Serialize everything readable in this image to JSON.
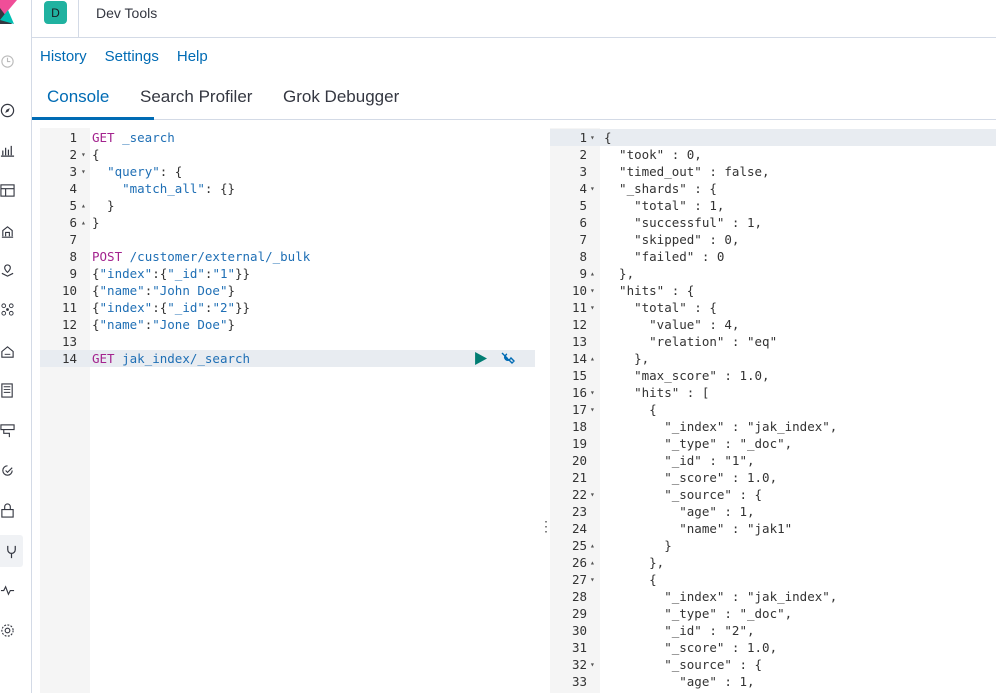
{
  "header": {
    "avatar_letter": "D",
    "app_title": "Dev Tools"
  },
  "menu": {
    "history": "History",
    "settings": "Settings",
    "help": "Help"
  },
  "tabs": [
    {
      "label": "Console"
    },
    {
      "label": "Search Profiler"
    },
    {
      "label": "Grok Debugger"
    }
  ],
  "sidenav": {
    "icons": [
      "clock-icon",
      "compass-icon",
      "visualize-icon",
      "dashboard-icon",
      "canvas-icon",
      "maps-icon",
      "ml-icon",
      "infrastructure-icon",
      "logs-icon",
      "apm-icon",
      "uptime-icon",
      "siem-icon",
      "devtools-icon",
      "monitoring-icon",
      "management-icon"
    ]
  },
  "editor": {
    "lines": [
      {
        "n": "1",
        "fold": "",
        "segments": [
          {
            "c": "verb",
            "t": "GET"
          },
          {
            "c": "plain",
            "t": " "
          },
          {
            "c": "str",
            "t": "_search"
          }
        ]
      },
      {
        "n": "2",
        "fold": "▾",
        "segments": [
          {
            "c": "plain",
            "t": "{"
          }
        ]
      },
      {
        "n": "3",
        "fold": "▾",
        "segments": [
          {
            "c": "plain",
            "t": "  "
          },
          {
            "c": "str",
            "t": "\"query\""
          },
          {
            "c": "plain",
            "t": ": {"
          }
        ]
      },
      {
        "n": "4",
        "fold": "",
        "segments": [
          {
            "c": "plain",
            "t": "    "
          },
          {
            "c": "str",
            "t": "\"match_all\""
          },
          {
            "c": "plain",
            "t": ": {}"
          }
        ]
      },
      {
        "n": "5",
        "fold": "▴",
        "segments": [
          {
            "c": "plain",
            "t": "  }"
          }
        ]
      },
      {
        "n": "6",
        "fold": "▴",
        "segments": [
          {
            "c": "plain",
            "t": "}"
          }
        ]
      },
      {
        "n": "7",
        "fold": "",
        "segments": []
      },
      {
        "n": "8",
        "fold": "",
        "segments": [
          {
            "c": "verb",
            "t": "POST"
          },
          {
            "c": "plain",
            "t": " "
          },
          {
            "c": "str",
            "t": "/customer/external/_bulk"
          }
        ]
      },
      {
        "n": "9",
        "fold": "",
        "segments": [
          {
            "c": "plain",
            "t": "{"
          },
          {
            "c": "str",
            "t": "\"index\""
          },
          {
            "c": "plain",
            "t": ":{"
          },
          {
            "c": "str",
            "t": "\"_id\""
          },
          {
            "c": "plain",
            "t": ":"
          },
          {
            "c": "str",
            "t": "\"1\""
          },
          {
            "c": "plain",
            "t": "}}"
          }
        ]
      },
      {
        "n": "10",
        "fold": "",
        "segments": [
          {
            "c": "plain",
            "t": "{"
          },
          {
            "c": "str",
            "t": "\"name\""
          },
          {
            "c": "plain",
            "t": ":"
          },
          {
            "c": "str",
            "t": "\"John Doe\""
          },
          {
            "c": "plain",
            "t": "}"
          }
        ]
      },
      {
        "n": "11",
        "fold": "",
        "segments": [
          {
            "c": "plain",
            "t": "{"
          },
          {
            "c": "str",
            "t": "\"index\""
          },
          {
            "c": "plain",
            "t": ":{"
          },
          {
            "c": "str",
            "t": "\"_id\""
          },
          {
            "c": "plain",
            "t": ":"
          },
          {
            "c": "str",
            "t": "\"2\""
          },
          {
            "c": "plain",
            "t": "}}"
          }
        ]
      },
      {
        "n": "12",
        "fold": "",
        "segments": [
          {
            "c": "plain",
            "t": "{"
          },
          {
            "c": "str",
            "t": "\"name\""
          },
          {
            "c": "plain",
            "t": ":"
          },
          {
            "c": "str",
            "t": "\"Jone Doe\""
          },
          {
            "c": "plain",
            "t": "}"
          }
        ]
      },
      {
        "n": "13",
        "fold": "",
        "segments": []
      },
      {
        "n": "14",
        "fold": "",
        "active": true,
        "segments": [
          {
            "c": "verb",
            "t": "GET"
          },
          {
            "c": "plain",
            "t": " "
          },
          {
            "c": "str",
            "t": "jak_index/_search"
          }
        ]
      }
    ]
  },
  "output": {
    "lines": [
      {
        "n": "1",
        "fold": "▾",
        "t": "{"
      },
      {
        "n": "2",
        "fold": "",
        "t": "  \"took\" : 0,"
      },
      {
        "n": "3",
        "fold": "",
        "t": "  \"timed_out\" : false,"
      },
      {
        "n": "4",
        "fold": "▾",
        "t": "  \"_shards\" : {"
      },
      {
        "n": "5",
        "fold": "",
        "t": "    \"total\" : 1,"
      },
      {
        "n": "6",
        "fold": "",
        "t": "    \"successful\" : 1,"
      },
      {
        "n": "7",
        "fold": "",
        "t": "    \"skipped\" : 0,"
      },
      {
        "n": "8",
        "fold": "",
        "t": "    \"failed\" : 0"
      },
      {
        "n": "9",
        "fold": "▴",
        "t": "  },"
      },
      {
        "n": "10",
        "fold": "▾",
        "t": "  \"hits\" : {"
      },
      {
        "n": "11",
        "fold": "▾",
        "t": "    \"total\" : {"
      },
      {
        "n": "12",
        "fold": "",
        "t": "      \"value\" : 4,"
      },
      {
        "n": "13",
        "fold": "",
        "t": "      \"relation\" : \"eq\""
      },
      {
        "n": "14",
        "fold": "▴",
        "t": "    },"
      },
      {
        "n": "15",
        "fold": "",
        "t": "    \"max_score\" : 1.0,"
      },
      {
        "n": "16",
        "fold": "▾",
        "t": "    \"hits\" : ["
      },
      {
        "n": "17",
        "fold": "▾",
        "t": "      {"
      },
      {
        "n": "18",
        "fold": "",
        "t": "        \"_index\" : \"jak_index\","
      },
      {
        "n": "19",
        "fold": "",
        "t": "        \"_type\" : \"_doc\","
      },
      {
        "n": "20",
        "fold": "",
        "t": "        \"_id\" : \"1\","
      },
      {
        "n": "21",
        "fold": "",
        "t": "        \"_score\" : 1.0,"
      },
      {
        "n": "22",
        "fold": "▾",
        "t": "        \"_source\" : {"
      },
      {
        "n": "23",
        "fold": "",
        "t": "          \"age\" : 1,"
      },
      {
        "n": "24",
        "fold": "",
        "t": "          \"name\" : \"jak1\""
      },
      {
        "n": "25",
        "fold": "▴",
        "t": "        }"
      },
      {
        "n": "26",
        "fold": "▴",
        "t": "      },"
      },
      {
        "n": "27",
        "fold": "▾",
        "t": "      {"
      },
      {
        "n": "28",
        "fold": "",
        "t": "        \"_index\" : \"jak_index\","
      },
      {
        "n": "29",
        "fold": "",
        "t": "        \"_type\" : \"_doc\","
      },
      {
        "n": "30",
        "fold": "",
        "t": "        \"_id\" : \"2\","
      },
      {
        "n": "31",
        "fold": "",
        "t": "        \"_score\" : 1.0,"
      },
      {
        "n": "32",
        "fold": "▾",
        "t": "        \"_source\" : {"
      },
      {
        "n": "33",
        "fold": "",
        "t": "          \"age\" : 1,"
      }
    ]
  }
}
